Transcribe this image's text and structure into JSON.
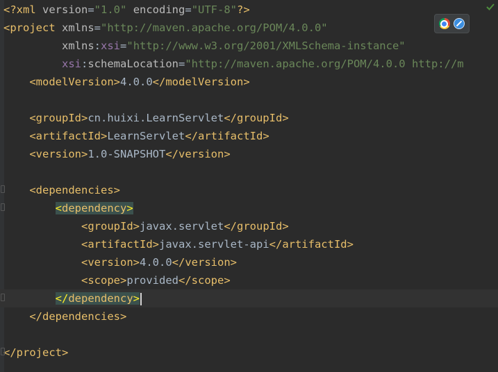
{
  "editor": {
    "lines": [
      {
        "parts": [
          [
            "bracket",
            "<?"
          ],
          [
            "tag",
            "xml "
          ],
          [
            "attr",
            "version"
          ],
          [
            "txt",
            "="
          ],
          [
            "val",
            "\"1.0\""
          ],
          [
            "txt",
            " "
          ],
          [
            "attr",
            "encoding"
          ],
          [
            "txt",
            "="
          ],
          [
            "val",
            "\"UTF-8\""
          ],
          [
            "bracket",
            "?>"
          ]
        ]
      },
      {
        "parts": [
          [
            "bracket",
            "<"
          ],
          [
            "tag",
            "project "
          ],
          [
            "attr",
            "xmlns"
          ],
          [
            "txt",
            "="
          ],
          [
            "val",
            "\"http://maven.apache.org/POM/4.0.0\""
          ]
        ]
      },
      {
        "parts": [
          [
            "txt",
            "         "
          ],
          [
            "attr",
            "xmlns"
          ],
          [
            "txt",
            ":"
          ],
          [
            "ns",
            "xsi"
          ],
          [
            "txt",
            "="
          ],
          [
            "val",
            "\"http://www.w3.org/2001/XMLSchema-instance\""
          ]
        ]
      },
      {
        "parts": [
          [
            "txt",
            "         "
          ],
          [
            "ns",
            "xsi"
          ],
          [
            "txt",
            ":"
          ],
          [
            "attr",
            "schemaLocation"
          ],
          [
            "txt",
            "="
          ],
          [
            "val",
            "\"http://maven.apache.org/POM/4.0.0 http://m"
          ]
        ]
      },
      {
        "parts": [
          [
            "txt",
            "    "
          ],
          [
            "bracket",
            "<"
          ],
          [
            "tag",
            "modelVersion"
          ],
          [
            "bracket",
            ">"
          ],
          [
            "txt",
            "4.0.0"
          ],
          [
            "bracket",
            "</"
          ],
          [
            "tag",
            "modelVersion"
          ],
          [
            "bracket",
            ">"
          ]
        ]
      },
      {
        "parts": []
      },
      {
        "parts": [
          [
            "txt",
            "    "
          ],
          [
            "bracket",
            "<"
          ],
          [
            "tag",
            "groupId"
          ],
          [
            "bracket",
            ">"
          ],
          [
            "txt",
            "cn.huixi.LearnServlet"
          ],
          [
            "bracket",
            "</"
          ],
          [
            "tag",
            "groupId"
          ],
          [
            "bracket",
            ">"
          ]
        ]
      },
      {
        "parts": [
          [
            "txt",
            "    "
          ],
          [
            "bracket",
            "<"
          ],
          [
            "tag",
            "artifactId"
          ],
          [
            "bracket",
            ">"
          ],
          [
            "txt",
            "LearnServlet"
          ],
          [
            "bracket",
            "</"
          ],
          [
            "tag",
            "artifactId"
          ],
          [
            "bracket",
            ">"
          ]
        ]
      },
      {
        "parts": [
          [
            "txt",
            "    "
          ],
          [
            "bracket",
            "<"
          ],
          [
            "tag",
            "version"
          ],
          [
            "bracket",
            ">"
          ],
          [
            "txt",
            "1.0-SNAPSHOT"
          ],
          [
            "bracket",
            "</"
          ],
          [
            "tag",
            "version"
          ],
          [
            "bracket",
            ">"
          ]
        ]
      },
      {
        "parts": []
      },
      {
        "parts": [
          [
            "txt",
            "    "
          ],
          [
            "bracket",
            "<"
          ],
          [
            "tag",
            "dependencies"
          ],
          [
            "bracket",
            ">"
          ]
        ]
      },
      {
        "parts": [
          [
            "txt",
            "        "
          ],
          [
            "hlb",
            "<"
          ],
          [
            "hlt",
            "dependency"
          ],
          [
            "hlb",
            ">"
          ]
        ]
      },
      {
        "parts": [
          [
            "txt",
            "            "
          ],
          [
            "bracket",
            "<"
          ],
          [
            "tag",
            "groupId"
          ],
          [
            "bracket",
            ">"
          ],
          [
            "txt",
            "javax.servlet"
          ],
          [
            "bracket",
            "</"
          ],
          [
            "tag",
            "groupId"
          ],
          [
            "bracket",
            ">"
          ]
        ]
      },
      {
        "parts": [
          [
            "txt",
            "            "
          ],
          [
            "bracket",
            "<"
          ],
          [
            "tag",
            "artifactId"
          ],
          [
            "bracket",
            ">"
          ],
          [
            "txt",
            "javax.servlet-api"
          ],
          [
            "bracket",
            "</"
          ],
          [
            "tag",
            "artifactId"
          ],
          [
            "bracket",
            ">"
          ]
        ]
      },
      {
        "parts": [
          [
            "txt",
            "            "
          ],
          [
            "bracket",
            "<"
          ],
          [
            "tag",
            "version"
          ],
          [
            "bracket",
            ">"
          ],
          [
            "txt",
            "4.0.0"
          ],
          [
            "bracket",
            "</"
          ],
          [
            "tag",
            "version"
          ],
          [
            "bracket",
            ">"
          ]
        ]
      },
      {
        "parts": [
          [
            "txt",
            "            "
          ],
          [
            "bracket",
            "<"
          ],
          [
            "tag",
            "scope"
          ],
          [
            "bracket",
            ">"
          ],
          [
            "txt",
            "provided"
          ],
          [
            "bracket",
            "</"
          ],
          [
            "tag",
            "scope"
          ],
          [
            "bracket",
            ">"
          ]
        ]
      },
      {
        "parts": [
          [
            "txt",
            "        "
          ],
          [
            "hlb",
            "</"
          ],
          [
            "hlt",
            "dependency"
          ],
          [
            "hlb",
            ">"
          ],
          [
            "caret",
            ""
          ]
        ],
        "current": true
      },
      {
        "parts": [
          [
            "txt",
            "    "
          ],
          [
            "bracket",
            "</"
          ],
          [
            "tag",
            "dependencies"
          ],
          [
            "bracket",
            ">"
          ]
        ]
      },
      {
        "parts": []
      },
      {
        "parts": [
          [
            "bracket",
            "</"
          ],
          [
            "tag",
            "project"
          ],
          [
            "bracket",
            ">"
          ]
        ]
      }
    ]
  },
  "browser_icons": [
    {
      "name": "chrome-icon",
      "color": "#dd4b39"
    },
    {
      "name": "safari-icon",
      "color": "#3b8ee0"
    }
  ]
}
